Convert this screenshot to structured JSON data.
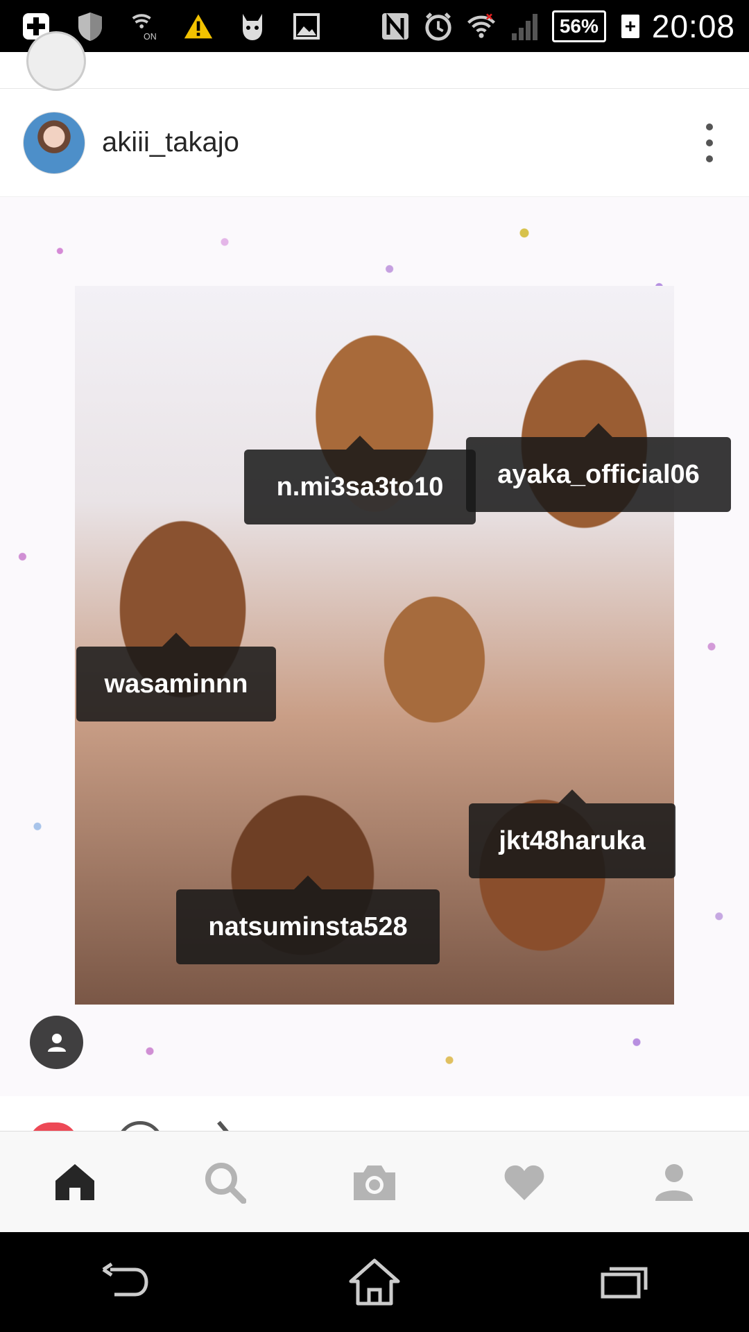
{
  "status_bar": {
    "time": "20:08",
    "battery_percent": "56%",
    "battery_plus": "+",
    "left_icons": [
      "plus-icon",
      "shield-icon",
      "nfc-on-icon",
      "warning-icon",
      "cat-icon",
      "image-icon"
    ],
    "right_icons": [
      "nfc-icon",
      "alarm-icon",
      "wifi-icon",
      "signal-icon",
      "battery-icon"
    ],
    "nfc_on_label": "ON"
  },
  "post": {
    "username": "akiii_takajo",
    "tags": [
      "n.mi3sa3to10",
      "ayaka_official06",
      "wasaminnn",
      "jkt48haruka",
      "natsuminsta528"
    ]
  },
  "bottom_nav": {
    "items": [
      "home-icon",
      "search-icon",
      "camera-icon",
      "heart-icon",
      "profile-icon"
    ],
    "active": "home-icon"
  },
  "android_nav": {
    "items": [
      "back-icon",
      "home-icon",
      "recents-icon"
    ]
  },
  "colors": {
    "like_red": "#ed4956",
    "nav_active": "#262626",
    "nav_inactive": "#b4b4b4"
  }
}
